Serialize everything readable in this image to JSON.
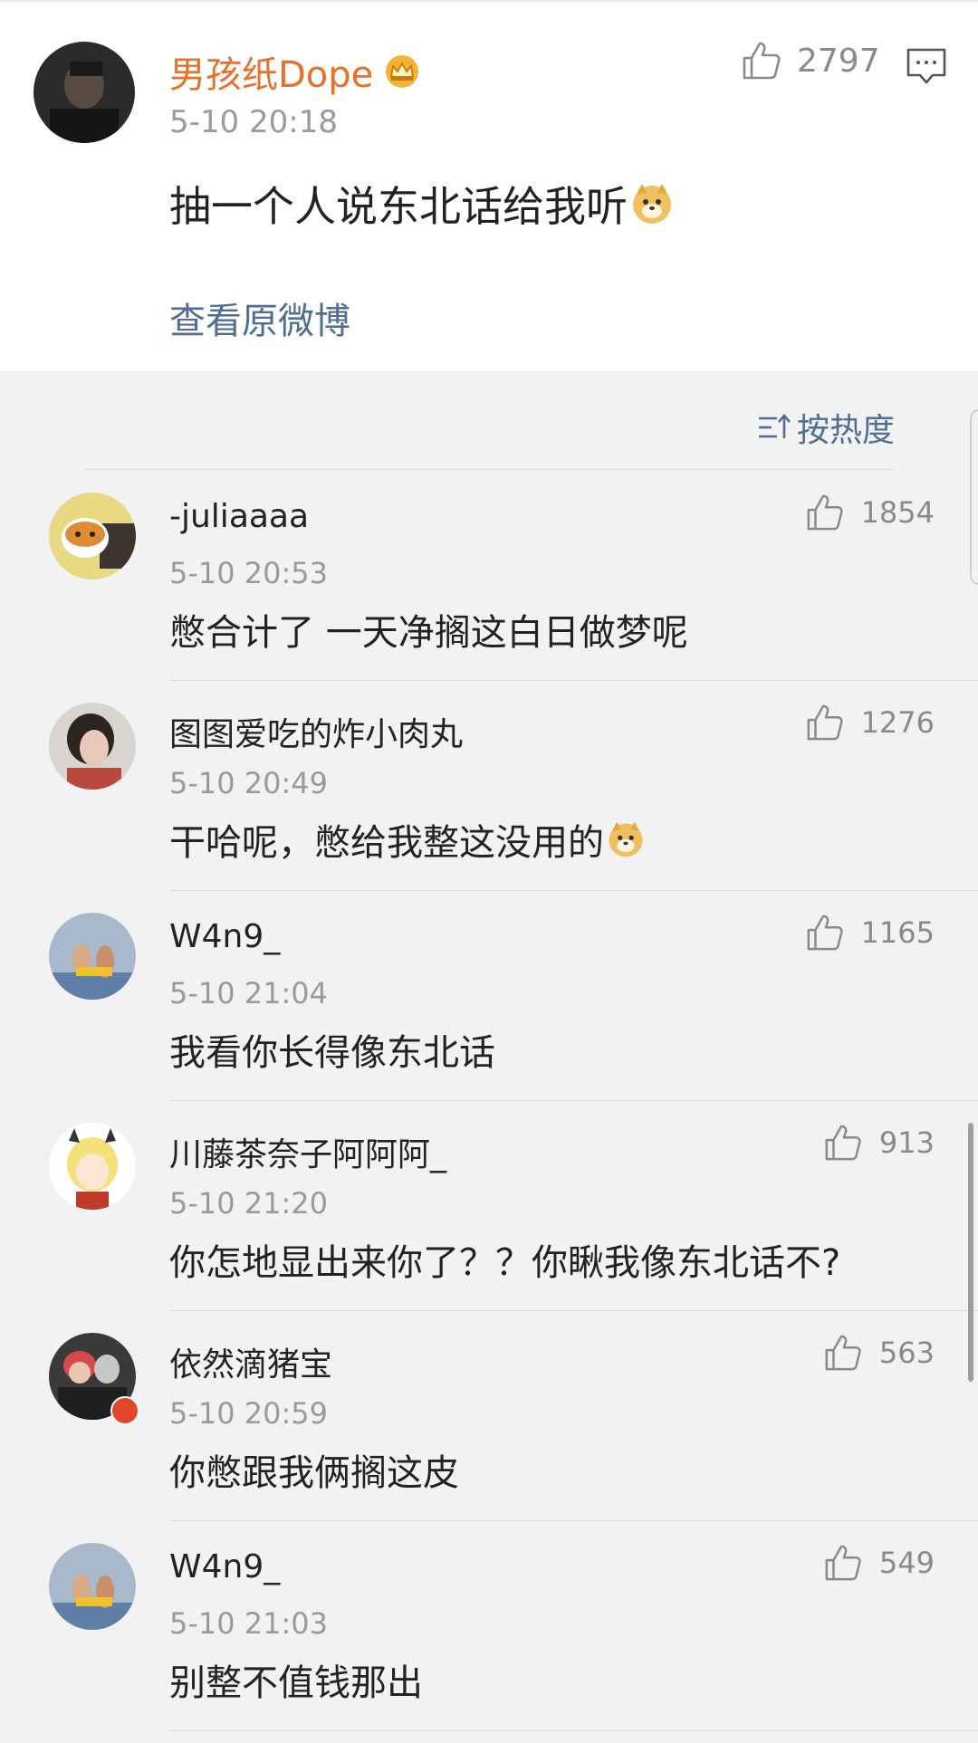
{
  "post": {
    "username": "男孩纸Dope",
    "time": "5-10 20:18",
    "content": "抽一个人说东北话给我听",
    "view_original": "查看原微博",
    "like_count": "2797",
    "icons": {
      "like": "thumbs-up-icon",
      "comment": "comment-icon",
      "crown": "crown-icon",
      "emoji": "doge-emoji"
    }
  },
  "sort": {
    "label": "按热度",
    "icon": "sort-icon"
  },
  "comments": [
    {
      "username": "-juliaaaa",
      "time": "5-10 20:53",
      "text": "憋合计了 一天净搁这白日做梦呢",
      "likes": "1854"
    },
    {
      "username": "图图爱吃的炸小肉丸",
      "time": "5-10 20:49",
      "text": "干哈呢，憋给我整这没用的",
      "likes": "1276"
    },
    {
      "username": "W4n9_",
      "time": "5-10 21:04",
      "text": "我看你长得像东北话",
      "likes": "1165"
    },
    {
      "username": "川藤茶奈子阿阿阿_",
      "time": "5-10 21:20",
      "text": "你怎地显出来你了？？你瞅我像东北话不?",
      "likes": "913"
    },
    {
      "username": "依然滴猪宝",
      "time": "5-10 20:59",
      "text": "你憋跟我俩搁这皮",
      "likes": "563"
    },
    {
      "username": "W4n9_",
      "time": "5-10 21:03",
      "text": "别整不值钱那出",
      "likes": "549"
    }
  ],
  "colors": {
    "username_vip": "#e8702a",
    "link": "#506e92",
    "meta": "#9a9a9a",
    "text": "#222222"
  }
}
